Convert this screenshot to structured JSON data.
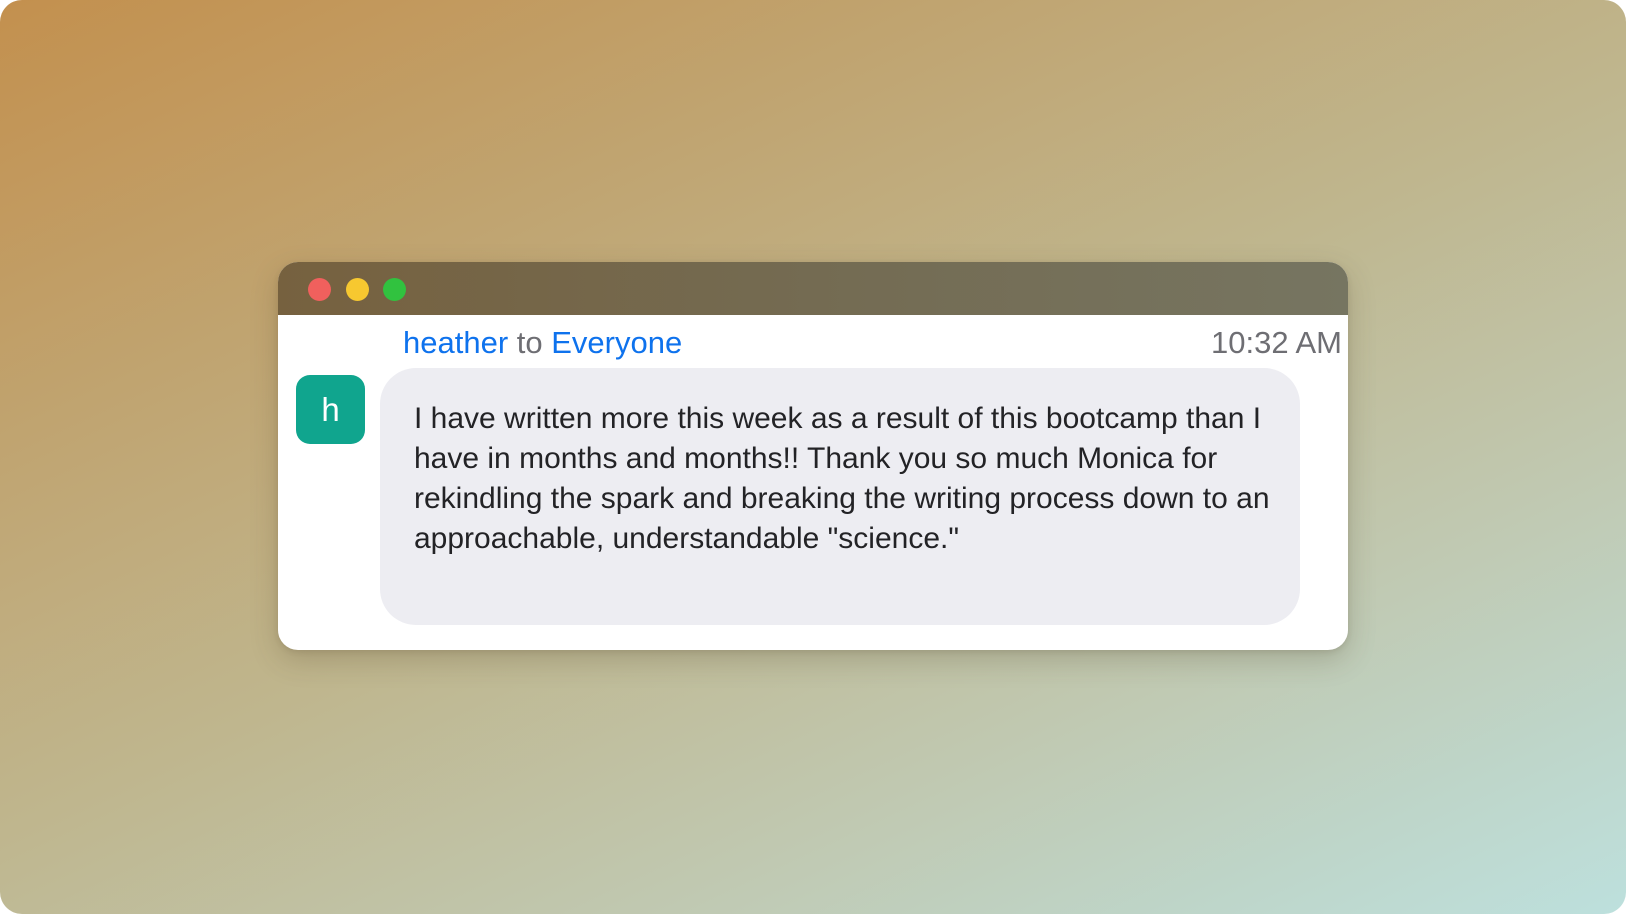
{
  "window_controls": {
    "close_icon": "close-dot-icon",
    "minimize_icon": "minimize-dot-icon",
    "zoom_icon": "zoom-dot-icon"
  },
  "chat": {
    "sender": "heather",
    "to_word": "to",
    "recipient": "Everyone",
    "timestamp": "10:32 AM",
    "avatar_initial": "h",
    "message": "I have written more this week as a result of this bootcamp than I have in months and months!! Thank you so much Monica for rekindling the spark and breaking the writing process down to an approachable, understandable \"science.\""
  },
  "colors": {
    "link_blue": "#0e72ed",
    "avatar_green": "#10a58e",
    "bubble_bg": "#ededf2",
    "close": "#f0605d",
    "minimize": "#f7c830",
    "zoom": "#31c23f"
  }
}
